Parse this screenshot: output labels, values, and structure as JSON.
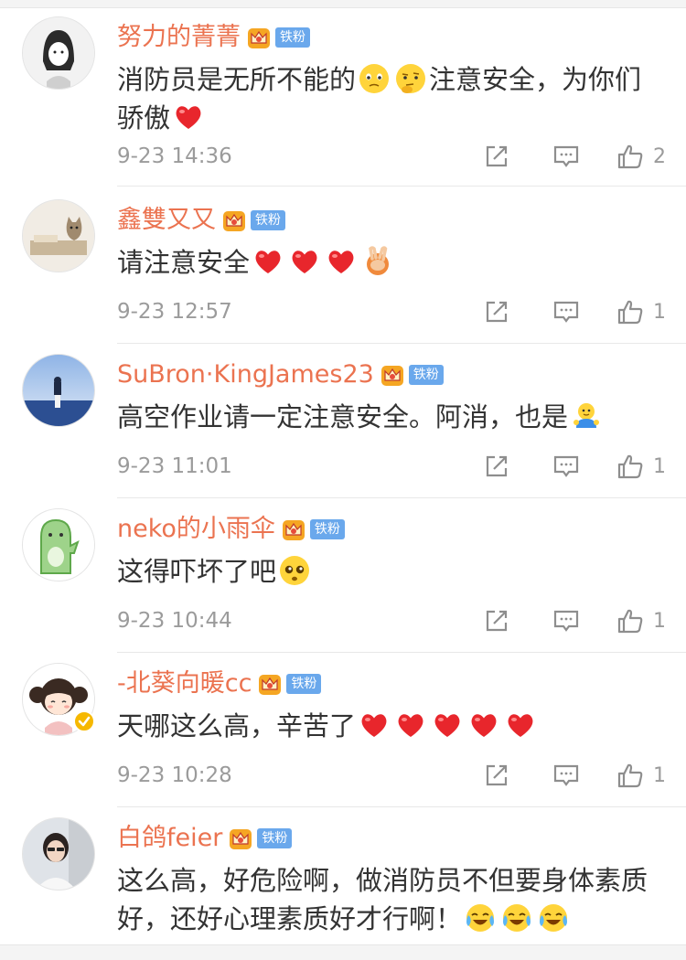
{
  "fan_badge": "铁粉",
  "comments": [
    {
      "username": "努力的菁菁",
      "text": "消防员是无所不能的",
      "text_after": "注意安全，为你们骄傲",
      "emojis_mid": [
        "sad",
        "thinking"
      ],
      "emojis_end": [
        "heart"
      ],
      "time": "9-23 14:36",
      "likes": "2",
      "avatar": "girl-sketch"
    },
    {
      "username": "鑫雙又又",
      "text": "请注意安全",
      "text_after": "",
      "emojis_mid": [],
      "emojis_end": [
        "heart",
        "heart",
        "heart",
        "victory-hand"
      ],
      "time": "9-23 12:57",
      "likes": "1",
      "avatar": "desk-cat"
    },
    {
      "username": "SuBron·KingJames23",
      "text": "高空作业请一定注意安全。阿消，也是",
      "text_after": "",
      "emojis_mid": [],
      "emojis_end": [
        "hug"
      ],
      "time": "9-23 11:01",
      "likes": "1",
      "avatar": "sea-person"
    },
    {
      "username": "neko的小雨伞",
      "text": "这得吓坏了吧",
      "text_after": "",
      "emojis_mid": [],
      "emojis_end": [
        "pleading"
      ],
      "time": "9-23 10:44",
      "likes": "1",
      "avatar": "green-dino"
    },
    {
      "username": "-北葵向暖cc",
      "text": "天哪这么高，辛苦了",
      "text_after": "",
      "emojis_mid": [],
      "emojis_end": [
        "heart",
        "heart",
        "heart",
        "heart",
        "heart"
      ],
      "time": "9-23 10:28",
      "likes": "1",
      "avatar": "cartoon-girl",
      "verified": true
    },
    {
      "username": "白鸽feier",
      "text": "这么高，好危险啊，做消防员不但要身体素质好，还好心理素质好才行啊！",
      "text_after": "",
      "emojis_mid": [],
      "emojis_end": [
        "crying-laugh",
        "crying-laugh",
        "crying-laugh"
      ],
      "time": "",
      "likes": "",
      "avatar": "woman-photo"
    }
  ],
  "colors": {
    "username": "#eb7350",
    "text": "#333333",
    "meta": "#9b9b9b",
    "fan_badge": "#6aa8ec",
    "heart": "#e8262c"
  }
}
